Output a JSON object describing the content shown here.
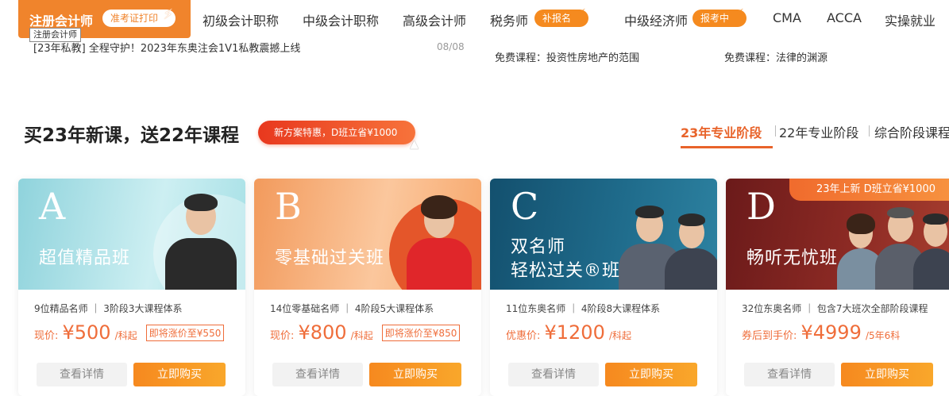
{
  "nav": {
    "active_label": "注册会计师",
    "active_badge": "准考证打印",
    "tooltip": "注册会计师",
    "items": [
      "初级会计职称",
      "中级会计职称",
      "高级会计师",
      "税务师",
      "中级经济师",
      "CMA",
      "ACCA",
      "实操就业"
    ],
    "tax_badge": "补报名",
    "econ_badge": "报考中",
    "bolt_icon": "⚡"
  },
  "news": {
    "left_text": "[23年私教] 全程守护！2023年东奥注会1V1私教震撼上线",
    "left_date": "08/08",
    "mid_text": "免费课程：投资性房地产的范围",
    "right_text": "免费课程：法律的渊源"
  },
  "section": {
    "title": "买23年新课，送22年课程",
    "promo": "新方案特惠，D班立省¥1000",
    "tabs": [
      "23年专业阶段",
      "22年专业阶段",
      "综合阶段课程"
    ],
    "active_tab_index": 0
  },
  "cards": [
    {
      "letter": "A",
      "name": "超值精品班",
      "meta": "9位精品名师 ｜ 3阶段3大课程体系",
      "price_label": "现价:",
      "price": "¥500",
      "unit": "/科起",
      "note": "即将涨价至¥550",
      "detail_btn": "查看详情",
      "buy_btn": "立即购买"
    },
    {
      "letter": "B",
      "name": "零基础过关班",
      "meta": "14位零基础名师 ｜ 4阶段5大课程体系",
      "price_label": "现价:",
      "price": "¥800",
      "unit": "/科起",
      "note": "即将涨价至¥850",
      "detail_btn": "查看详情",
      "buy_btn": "立即购买"
    },
    {
      "letter": "C",
      "name_line1": "双名师",
      "name_line2": "轻松过关®班",
      "meta": "11位东奥名师 ｜ 4阶段8大课程体系",
      "price_label": "优惠价:",
      "price": "¥1200",
      "unit": "/科起",
      "detail_btn": "查看详情",
      "buy_btn": "立即购买"
    },
    {
      "letter": "D",
      "name": "畅听无忧班",
      "corner_tag": "23年上新 D班立省¥1000",
      "meta": "32位东奥名师 ｜ 包含7大班次全部阶段课程",
      "price_label": "券后到手价:",
      "price": "¥4999",
      "unit": "/5年6科",
      "detail_btn": "查看详情",
      "buy_btn": "立即购买"
    }
  ]
}
